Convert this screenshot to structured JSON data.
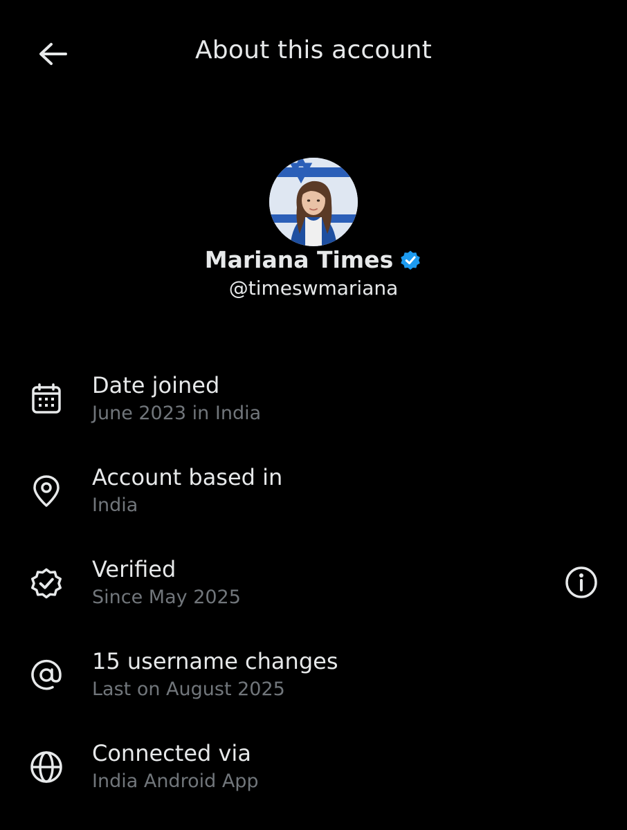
{
  "header": {
    "title": "About this account",
    "back_icon": "arrow-left-icon"
  },
  "profile": {
    "display_name": "Mariana Times",
    "handle": "@timeswmariana",
    "verified_badge_icon": "verified-badge-icon",
    "verified_color": "#1d9bf0"
  },
  "details": [
    {
      "icon": "calendar-icon",
      "title": "Date joined",
      "subtitle": "June 2023 in India"
    },
    {
      "icon": "location-pin-icon",
      "title": "Account based in",
      "subtitle": "India"
    },
    {
      "icon": "verified-icon",
      "title": "Verified",
      "subtitle": "Since May 2025",
      "action_icon": "info-icon"
    },
    {
      "icon": "at-sign-icon",
      "title": "15 username changes",
      "subtitle": "Last on August 2025"
    },
    {
      "icon": "globe-icon",
      "title": "Connected via",
      "subtitle": "India Android App"
    }
  ],
  "colors": {
    "background": "#000000",
    "primary_text": "#e7e9ea",
    "secondary_text": "#71767b",
    "accent": "#1d9bf0"
  }
}
